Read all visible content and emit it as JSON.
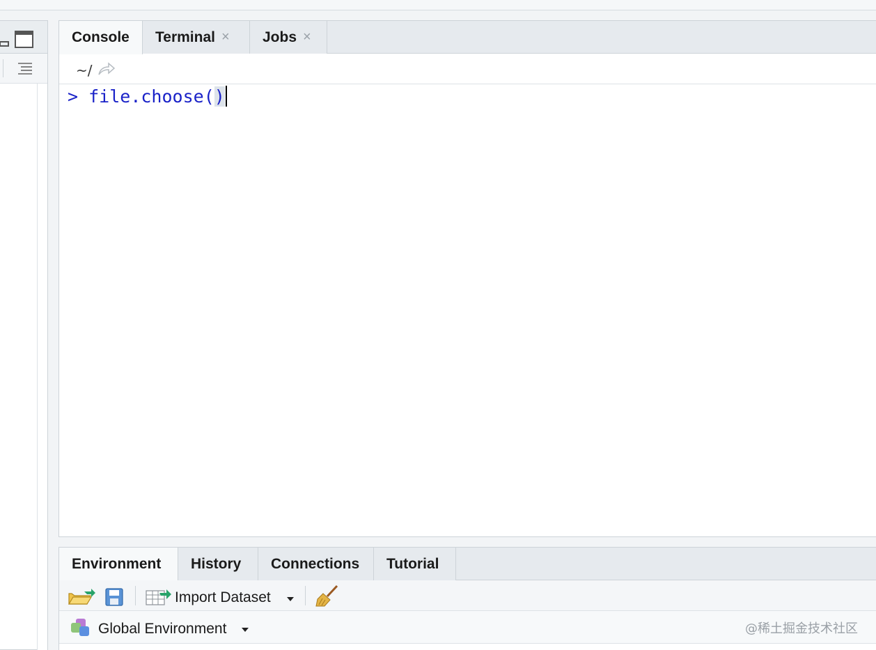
{
  "console_pane": {
    "tabs": [
      {
        "label": "Console",
        "active": true,
        "closable": false
      },
      {
        "label": "Terminal",
        "active": false,
        "closable": true
      },
      {
        "label": "Jobs",
        "active": false,
        "closable": true
      }
    ],
    "close_glyph": "×",
    "working_dir": "~/",
    "prompt": ">",
    "input_text_pre": "file.choose(",
    "input_text_post": ")"
  },
  "env_pane": {
    "tabs": [
      {
        "label": "Environment",
        "active": true
      },
      {
        "label": "History",
        "active": false
      },
      {
        "label": "Connections",
        "active": false
      },
      {
        "label": "Tutorial",
        "active": false
      }
    ],
    "import_dataset_label": "Import Dataset",
    "scope_label": "Global Environment",
    "watermark": "@稀土掘金技术社区"
  },
  "colors": {
    "console_text": "#1a22c8",
    "tab_bg": "#e6eaee",
    "active_tab_bg": "#f7f9fa",
    "border": "#cdd3d8"
  },
  "icons": {
    "minimize": "minimize-icon",
    "maximize": "maximize-icon",
    "outline": "outline-list-icon",
    "goto_dir": "goto-directory-icon",
    "open": "open-folder-icon",
    "save": "save-icon",
    "import": "import-dataset-icon",
    "clear": "broom-icon",
    "env": "environment-icon"
  }
}
